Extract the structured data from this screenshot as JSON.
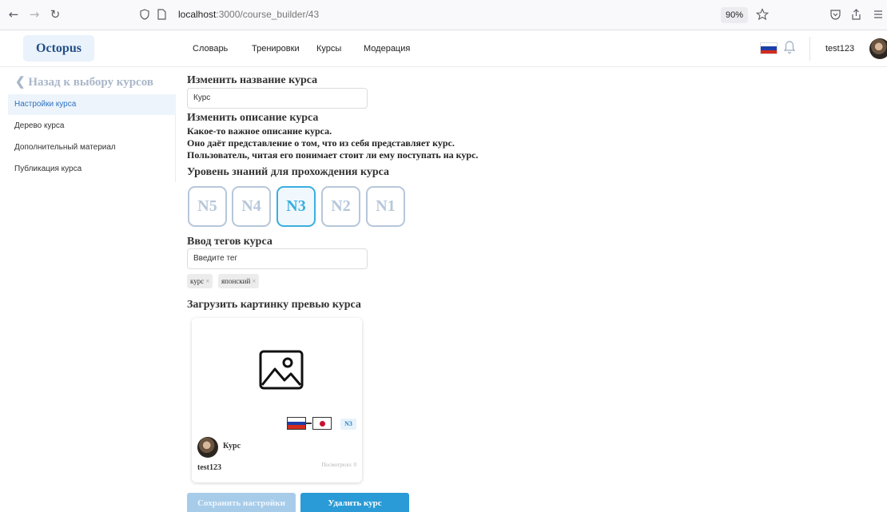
{
  "browser": {
    "url_host": "localhost",
    "url_path": ":3000/course_builder/43",
    "zoom": "90%"
  },
  "header": {
    "logo": "Octopus",
    "nav": [
      "Словарь",
      "Тренировки",
      "Курсы",
      "Модерация"
    ],
    "username": "test123"
  },
  "sidebar": {
    "back_label": "Назад к выбору курсов",
    "items": [
      {
        "label": "Настройки курса",
        "active": true
      },
      {
        "label": "Дерево курса",
        "active": false
      },
      {
        "label": "Дополнительный материал",
        "active": false
      },
      {
        "label": "Публикация курса",
        "active": false
      }
    ]
  },
  "form": {
    "name_label": "Изменить название курса",
    "name_value": "Курс",
    "desc_label": "Изменить описание курса",
    "desc_lines": [
      "Какое-то важное описание курса.",
      "Оно даёт представление о том, что из себя представляет курс.",
      "Пользователь, читая его понимает стоит ли ему поступать на курс."
    ],
    "level_label": "Уровень знаний для прохождения курса",
    "levels": [
      "N5",
      "N4",
      "N3",
      "N2",
      "N1"
    ],
    "selected_level": "N3",
    "tags_label": "Ввод тегов курса",
    "tags_placeholder": "Введите тег",
    "tags": [
      "курс",
      "японский"
    ],
    "tag_remove_glyph": "×",
    "image_label": "Загрузить картинку превью курса"
  },
  "preview": {
    "level_badge": "N3",
    "title": "Курс",
    "author": "test123",
    "views": "Посмотрело: 0"
  },
  "buttons": {
    "save": "Сохранить настройки",
    "delete": "Удалить курс"
  },
  "colors": {
    "accent": "#2a9bd6",
    "selected_level": "#3aaee0",
    "level_border": "#b6c7da",
    "sidebar_active_bg": "#eef4fb"
  },
  "icons": {
    "back": "chevron-left-icon",
    "notifications": "bell-icon",
    "image_placeholder": "image-icon",
    "flag_ru": "russian-flag-icon",
    "flag_jp": "japanese-flag-icon"
  }
}
